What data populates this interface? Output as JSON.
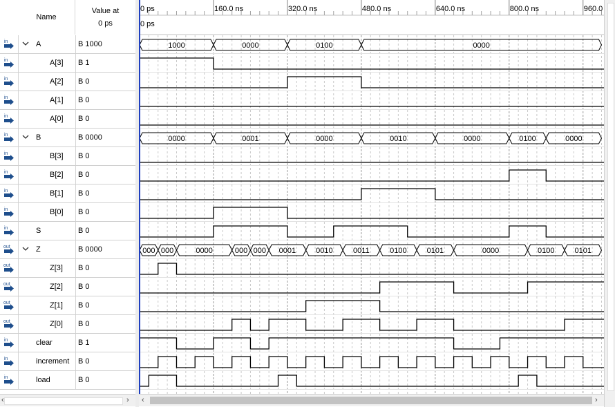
{
  "header": {
    "name_label": "Name",
    "value_label": "Value at",
    "value_time": "0 ps"
  },
  "timeline": {
    "ticks": [
      "0 ps",
      "160.0 ns",
      "320.0 ns",
      "480.0 ns",
      "640.0 ns",
      "800.0 ns",
      "960.0 ns"
    ],
    "cursor_label": "0 ps"
  },
  "signals": [
    {
      "name": "A",
      "dir": "in",
      "bus": true,
      "value": "B 1000",
      "segments": [
        [
          0,
          160,
          "1000"
        ],
        [
          160,
          320,
          "0000"
        ],
        [
          320,
          480,
          "0100"
        ],
        [
          480,
          1000,
          "0000"
        ]
      ]
    },
    {
      "name": "A[3]",
      "dir": "in",
      "value": "B 1",
      "init": 1,
      "edges": [
        160
      ]
    },
    {
      "name": "A[2]",
      "dir": "in",
      "value": "B 0",
      "init": 0,
      "edges": [
        320,
        480
      ]
    },
    {
      "name": "A[1]",
      "dir": "in",
      "value": "B 0",
      "init": 0,
      "edges": []
    },
    {
      "name": "A[0]",
      "dir": "in",
      "value": "B 0",
      "init": 0,
      "edges": []
    },
    {
      "name": "B",
      "dir": "in",
      "bus": true,
      "value": "B 0000",
      "segments": [
        [
          0,
          160,
          "0000"
        ],
        [
          160,
          320,
          "0001"
        ],
        [
          320,
          480,
          "0000"
        ],
        [
          480,
          640,
          "0010"
        ],
        [
          640,
          800,
          "0000"
        ],
        [
          800,
          880,
          "0100"
        ],
        [
          880,
          1000,
          "0000"
        ]
      ]
    },
    {
      "name": "B[3]",
      "dir": "in",
      "value": "B 0",
      "init": 0,
      "edges": []
    },
    {
      "name": "B[2]",
      "dir": "in",
      "value": "B 0",
      "init": 0,
      "edges": [
        800,
        880
      ]
    },
    {
      "name": "B[1]",
      "dir": "in",
      "value": "B 0",
      "init": 0,
      "edges": [
        480,
        640
      ]
    },
    {
      "name": "B[0]",
      "dir": "in",
      "value": "B 0",
      "init": 0,
      "edges": [
        160,
        320
      ]
    },
    {
      "name": "S",
      "dir": "in",
      "value": "B 0",
      "init": 0,
      "edges": [
        160,
        320,
        420,
        580,
        800,
        880
      ]
    },
    {
      "name": "Z",
      "dir": "out",
      "bus": true,
      "value": "B 0000",
      "segments": [
        [
          0,
          40,
          "000"
        ],
        [
          40,
          80,
          "000"
        ],
        [
          80,
          200,
          "0000"
        ],
        [
          200,
          240,
          "000"
        ],
        [
          240,
          280,
          "000"
        ],
        [
          280,
          360,
          "0001"
        ],
        [
          360,
          440,
          "0010"
        ],
        [
          440,
          520,
          "0011"
        ],
        [
          520,
          600,
          "0100"
        ],
        [
          600,
          680,
          "0101"
        ],
        [
          680,
          840,
          "0000"
        ],
        [
          840,
          920,
          "0100"
        ],
        [
          920,
          1000,
          "0101"
        ]
      ]
    },
    {
      "name": "Z[3]",
      "dir": "out",
      "value": "B 0",
      "init": 0,
      "edges": [
        40,
        80
      ]
    },
    {
      "name": "Z[2]",
      "dir": "out",
      "value": "B 0",
      "init": 0,
      "edges": [
        520,
        680,
        840
      ]
    },
    {
      "name": "Z[1]",
      "dir": "out",
      "value": "B 0",
      "init": 0,
      "edges": [
        360,
        520
      ]
    },
    {
      "name": "Z[0]",
      "dir": "out",
      "value": "B 0",
      "init": 0,
      "edges": [
        200,
        240,
        280,
        360,
        440,
        520,
        600,
        680,
        920
      ]
    },
    {
      "name": "clear",
      "dir": "in",
      "value": "B 1",
      "init": 1,
      "edges": [
        80,
        160,
        240,
        280,
        680,
        780
      ]
    },
    {
      "name": "increment",
      "dir": "in",
      "value": "B 0",
      "init": 0,
      "edges": [
        40,
        80,
        120,
        160,
        200,
        240,
        280,
        320,
        360,
        400,
        440,
        480,
        520,
        560,
        600,
        640,
        680,
        720,
        760,
        800,
        840,
        880,
        920,
        960
      ]
    },
    {
      "name": "load",
      "dir": "in",
      "value": "B 0",
      "init": 0,
      "edges": [
        20,
        80,
        300,
        340,
        820,
        860
      ]
    }
  ],
  "colors": {
    "cursor": "#1f3fbf",
    "wave": "#000000",
    "grid": "#b0b0b0",
    "icon": "#1e4e8c"
  }
}
